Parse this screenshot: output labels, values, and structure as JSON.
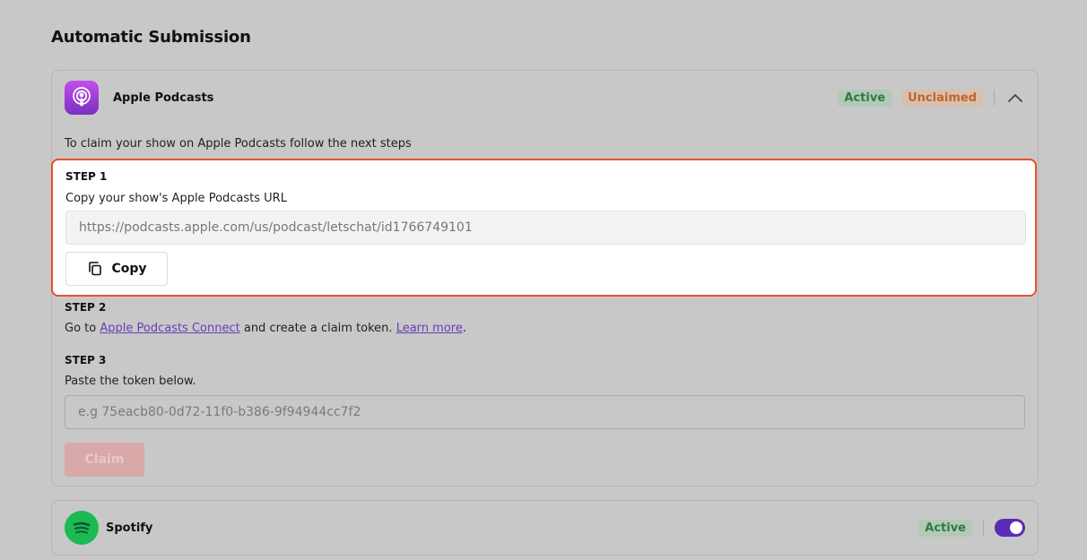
{
  "page": {
    "title": "Automatic Submission"
  },
  "apple": {
    "name": "Apple Podcasts",
    "badge_active": "Active",
    "badge_unclaimed": "Unclaimed",
    "intro": "To claim your show on Apple Podcasts follow the next steps",
    "step1": {
      "label": "STEP 1",
      "desc": "Copy your show's Apple Podcasts URL",
      "url": "https://podcasts.apple.com/us/podcast/letschat/id1766749101",
      "copy_label": "Copy"
    },
    "step2": {
      "label": "STEP 2",
      "prefix": "Go to ",
      "link1": "Apple Podcasts Connect",
      "middle": " and create a claim token. ",
      "link2": "Learn more",
      "suffix": "."
    },
    "step3": {
      "label": "STEP 3",
      "desc": "Paste the token below.",
      "placeholder": "e.g 75eacb80-0d72-11f0-b386-9f94944cc7f2",
      "claim_label": "Claim"
    }
  },
  "spotify": {
    "name": "Spotify",
    "badge_active": "Active",
    "toggle_on": true
  },
  "colors": {
    "highlight_border": "#e8522a",
    "toggle": "#5a2bb5",
    "active_badge_text": "#2f7a44",
    "unclaimed_badge_text": "#c0662a",
    "link": "#6c3bb8"
  },
  "icons": {
    "apple_app": "podcast-icon",
    "spotify_app": "spotify-icon",
    "collapse": "chevron-up-icon",
    "copy": "copy-icon"
  }
}
